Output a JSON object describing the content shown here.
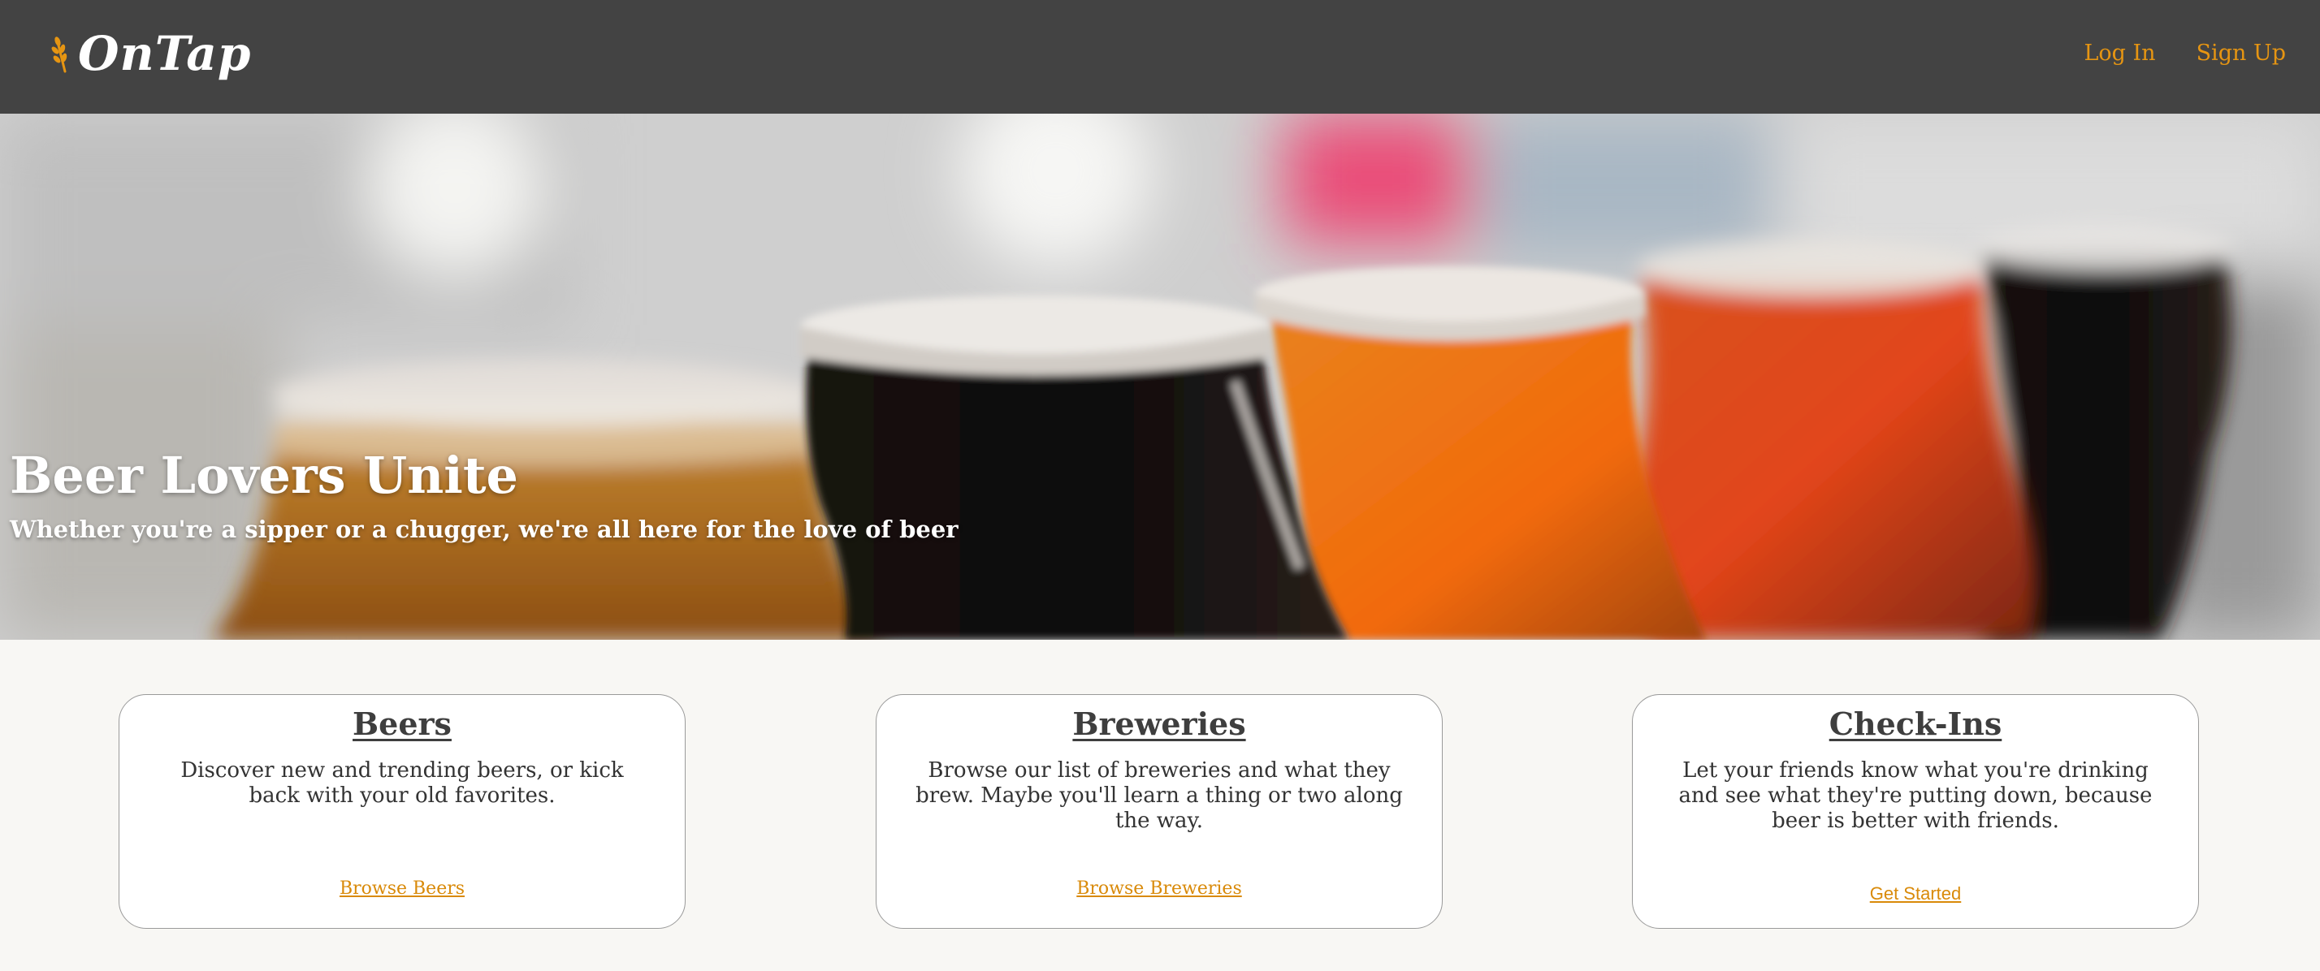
{
  "header": {
    "logo_text": "OnTap",
    "nav": {
      "login": "Log In",
      "signup": "Sign Up"
    }
  },
  "hero": {
    "title": "Beer Lovers Unite",
    "subtitle": "Whether you're a sipper or a chugger, we're all here for the love of beer"
  },
  "cards": [
    {
      "title": "Beers",
      "description": "Discover new and trending beers, or kick back with your old favorites.",
      "link": "Browse Beers"
    },
    {
      "title": "Breweries",
      "description": "Browse our list of breweries and what they brew. Maybe you'll learn a thing or two along the way.",
      "link": "Browse Breweries"
    },
    {
      "title": "Check-Ins",
      "description": "Let your friends know what you're drinking and see what they're putting down, because beer is better with friends.",
      "link": "Get Started"
    }
  ],
  "colors": {
    "header_bg": "#434343",
    "accent": "#e69512",
    "page_bg": "#f8f7f4"
  },
  "icons": {
    "logo": "wheat-icon"
  }
}
